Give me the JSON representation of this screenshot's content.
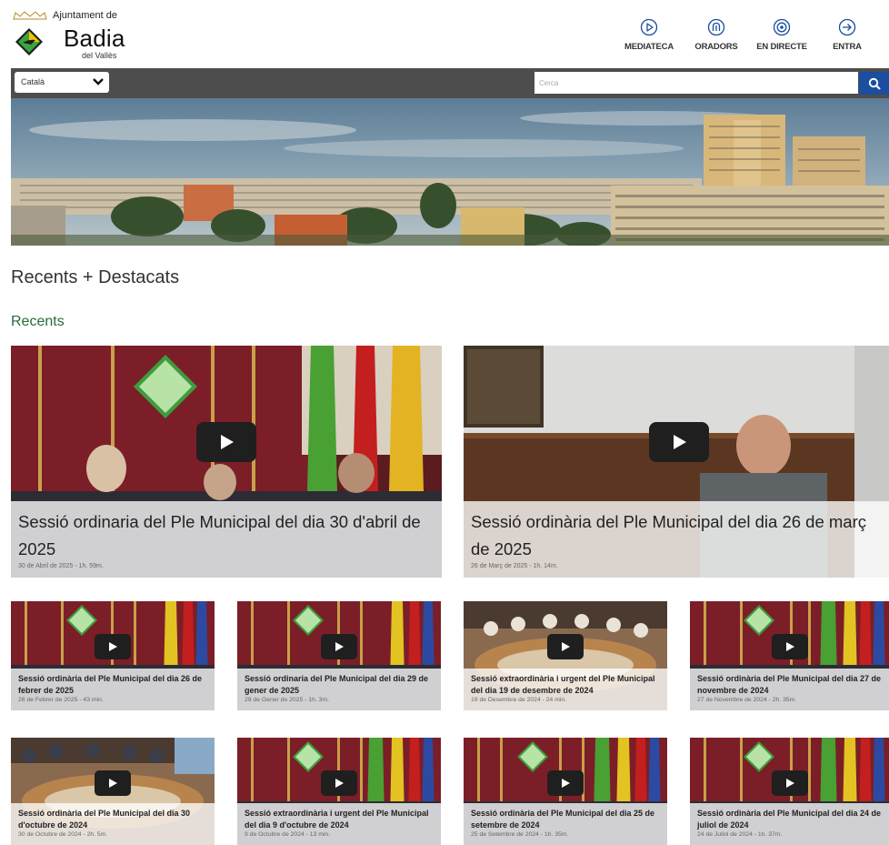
{
  "header": {
    "logo_pre": "Ajuntament de",
    "logo_name": "Badia",
    "logo_sub": "del Vallès",
    "nav": [
      {
        "label": "MEDIATECA",
        "icon": "play-circle-icon"
      },
      {
        "label": "ORADORS",
        "icon": "speaker-icon"
      },
      {
        "label": "EN DIRECTE",
        "icon": "live-broadcast-icon"
      },
      {
        "label": "ENTRA",
        "icon": "login-icon"
      }
    ]
  },
  "bar": {
    "language": "Català",
    "search_placeholder": "Cerca"
  },
  "sections": {
    "main": "Recents + Destacats",
    "recents": "Recents"
  },
  "videos": [
    {
      "title": "Sessió ordinaria del Ple Municipal del dia 30 d'abril de 2025",
      "meta": "30 de Abril de 2025 - 1h. 59m."
    },
    {
      "title": "Sessió ordinària del Ple Municipal del dia 26 de març de 2025",
      "meta": "26 de Març de 2025 - 1h. 14m."
    },
    {
      "title": "Sessió ordinària del Ple Municipal del dia 26 de febrer de 2025",
      "meta": "26 de Febrer de 2025 - 43 min."
    },
    {
      "title": "Sessió ordinaria del Ple Municipal del dia 29 de gener de 2025",
      "meta": "29 de Gener de 2025 - 1h. 3m."
    },
    {
      "title": "Sessió extraordinària i urgent del Ple Municipal del dia 19 de desembre de 2024",
      "meta": "19 de Desembre de 2024 - 24 min."
    },
    {
      "title": "Sessió ordinària del Ple Municipal del dia 27 de novembre de 2024",
      "meta": "27 de Novembre de 2024 - 2h. 35m."
    },
    {
      "title": "Sessió ordinària del Ple Municipal del dia 30 d'octubre de 2024",
      "meta": "30 de Octubre de 2024 - 2h. 5m."
    },
    {
      "title": "Sessió extraordinària i urgent del Ple Municipal del dia 9 d'octubre de 2024",
      "meta": "9 de Octubre de 2024 - 13 min."
    },
    {
      "title": "Sessió ordinària del Ple Municipal del dia 25 de setembre de 2024",
      "meta": "25 de Setembre de 2024 - 1h. 35m."
    },
    {
      "title": "Sessió ordinària del Ple Municipal del dia 24 de juliol de 2024",
      "meta": "24 de Juliol de 2024 - 1h. 37m."
    }
  ]
}
